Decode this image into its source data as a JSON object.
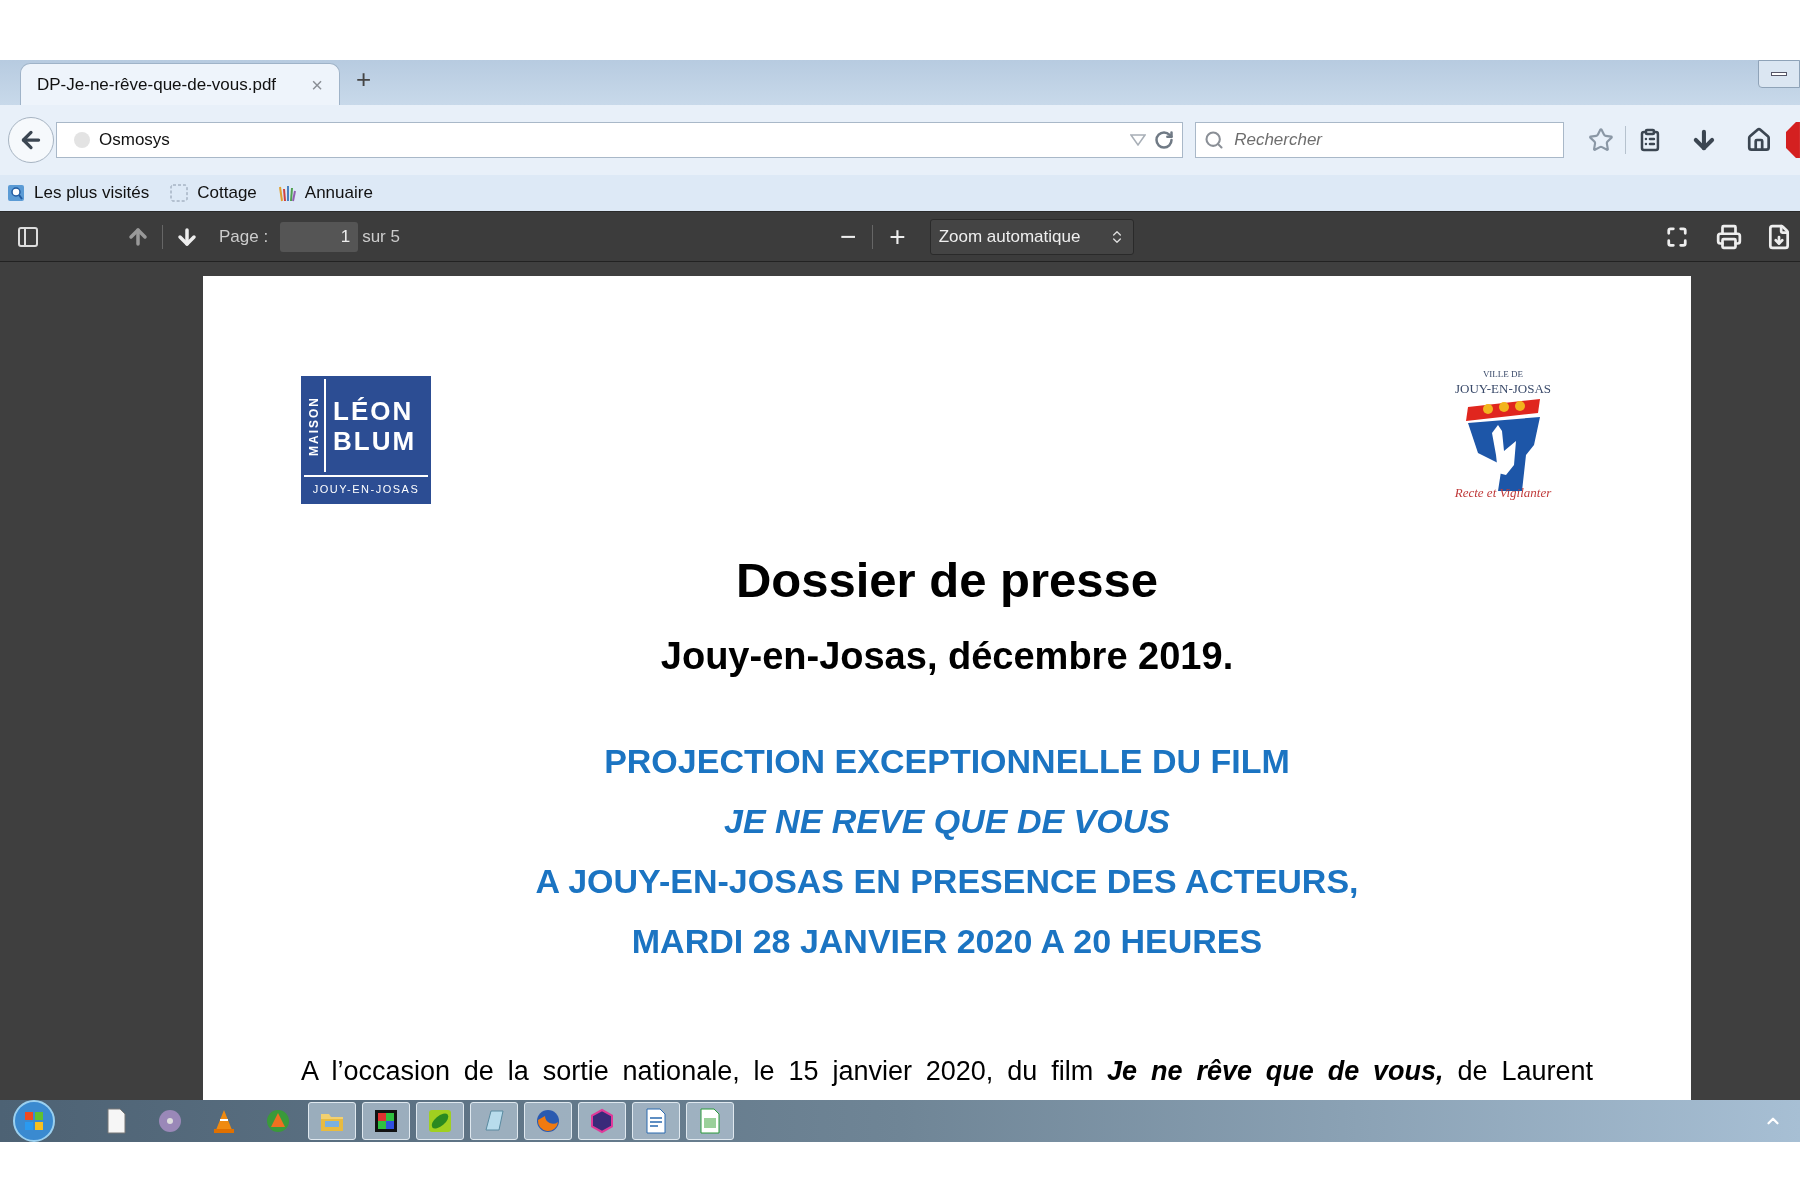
{
  "browser": {
    "tabs": [
      {
        "title": "DP-Je-ne-rêve-que-de-vous.pdf",
        "close": "×",
        "selected": true
      }
    ],
    "new_tab": "+",
    "address": {
      "value": "Osmosys"
    },
    "search": {
      "placeholder": "Rechercher"
    },
    "bookmarks": [
      {
        "label": "Les plus visités",
        "kind": "folder"
      },
      {
        "label": "Cottage",
        "kind": "page"
      },
      {
        "label": "Annuaire",
        "kind": "bars"
      }
    ]
  },
  "pdf_toolbar": {
    "page_label": "Page :",
    "page_value": "1",
    "page_count": "sur 5",
    "zoom_out": "−",
    "zoom_in": "+",
    "zoom": "Zoom automatique"
  },
  "document": {
    "logo_left": {
      "side": "MAISON",
      "name_1": "LÉON",
      "name_2": "BLUM",
      "place": "JOUY-EN-JOSAS"
    },
    "logo_right": {
      "top": "VILLE DE",
      "name": "JOUY-EN-JOSAS",
      "motto": "Recte et Vigilanter"
    },
    "title": "Dossier de presse",
    "subtitle": "Jouy-en-Josas, décembre 2019.",
    "headline": [
      {
        "text": "PROJECTION EXCEPTIONNELLE DU FILM",
        "italic": false
      },
      {
        "text": "JE NE REVE QUE DE VOUS",
        "italic": true
      },
      {
        "text": "A JOUY-EN-JOSAS EN PRESENCE DES ACTEURS,",
        "italic": false
      },
      {
        "text": "MARDI 28 JANVIER 2020 A 20 HEURES",
        "italic": false
      }
    ],
    "paragraph": "A l’occasion de la sortie nationale, le 15 janvier 2020, du film **Je ne rêve que de vous,** de Laurent"
  },
  "taskbar": {
    "apps": [
      {
        "kind": "document",
        "running": false
      },
      {
        "kind": "disc",
        "running": false
      },
      {
        "kind": "cone",
        "running": false
      },
      {
        "kind": "triangle",
        "running": false
      },
      {
        "kind": "folder",
        "running": true
      },
      {
        "kind": "film",
        "running": true
      },
      {
        "kind": "pea",
        "running": true
      },
      {
        "kind": "tablet",
        "running": true
      },
      {
        "kind": "firefox",
        "running": true
      },
      {
        "kind": "mail",
        "running": true
      },
      {
        "kind": "writer",
        "running": true
      },
      {
        "kind": "calc",
        "running": true
      }
    ]
  }
}
